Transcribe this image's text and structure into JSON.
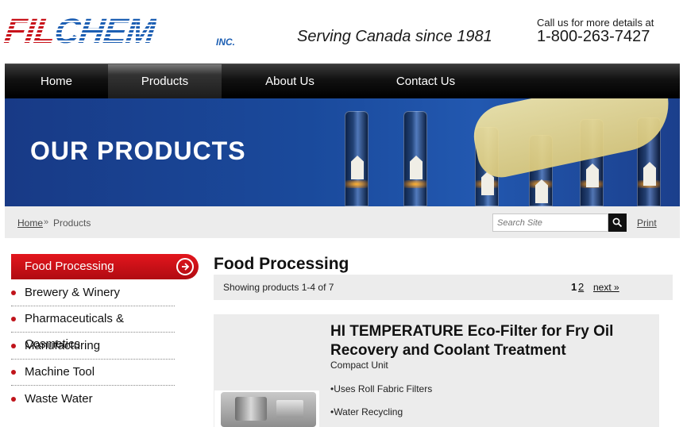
{
  "header": {
    "logo_text_red": "FIL",
    "logo_text_blue": "CHEM",
    "logo_suffix": "INC.",
    "tagline": "Serving Canada since 1981",
    "call_label": "Call us for more details at",
    "phone": "1-800-263-7427"
  },
  "nav": {
    "items": [
      {
        "label": "Home"
      },
      {
        "label": "Products",
        "active": true
      },
      {
        "label": "About Us"
      },
      {
        "label": "Contact Us"
      }
    ]
  },
  "banner": {
    "title": "OUR PRODUCTS"
  },
  "breadcrumb": {
    "home": "Home",
    "separator": "»",
    "current": "Products"
  },
  "search": {
    "placeholder": "Search Site",
    "icon": "search-icon"
  },
  "print_label": "Print",
  "sidebar": {
    "active": "Food Processing",
    "items": [
      {
        "label": "Brewery & Winery"
      },
      {
        "label": "Pharmaceuticals & Cosmetics"
      },
      {
        "label": "Manufacturing"
      },
      {
        "label": "Machine Tool"
      },
      {
        "label": "Waste Water"
      }
    ]
  },
  "main": {
    "title": "Food Processing",
    "showing": "Showing products 1-4 of 7",
    "pages": [
      "1",
      "2"
    ],
    "current_page": "1",
    "next_label": "next »"
  },
  "product": {
    "name": "HI TEMPERATURE Eco-Filter for Fry Oil Recovery and Coolant Treatment",
    "subtitle": "Compact Unit",
    "features": [
      "•Uses Roll Fabric Filters",
      "•Water Recycling"
    ]
  },
  "colors": {
    "accent_red": "#d4141c",
    "brand_blue": "#1d5fb3",
    "nav_bg": "#000000",
    "banner_blue": "#1a4a9c"
  }
}
